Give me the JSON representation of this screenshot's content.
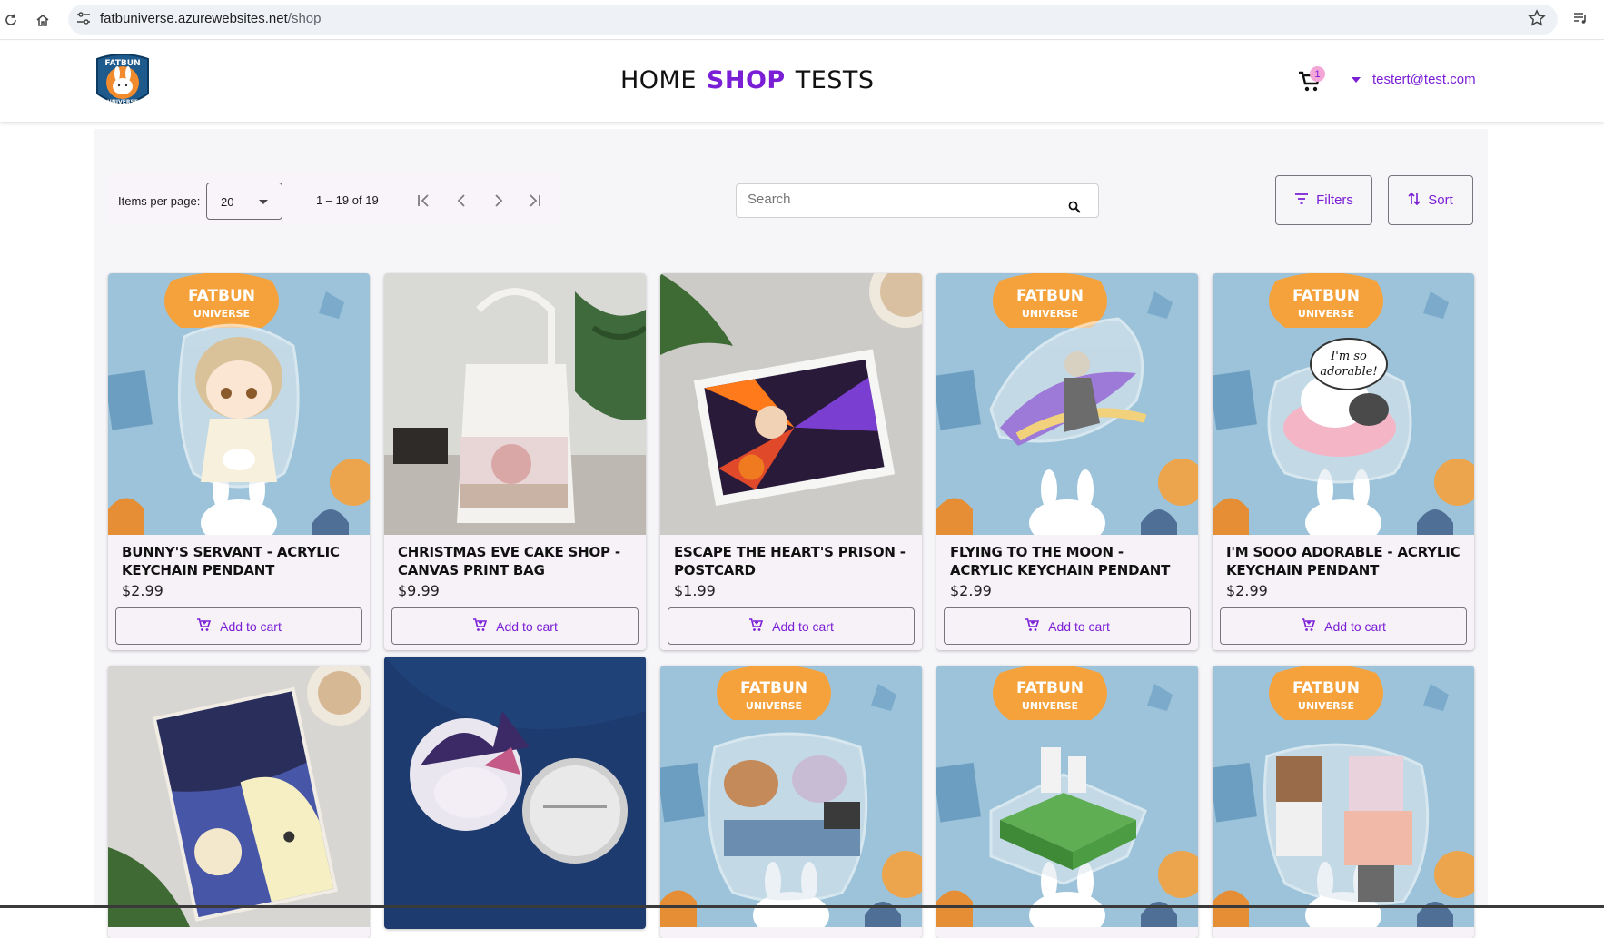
{
  "browser": {
    "url_host": "fatbuniverse.azurewebsites.net",
    "url_path": "/shop"
  },
  "header": {
    "nav": [
      {
        "label": "HOME",
        "active": false
      },
      {
        "label": "SHOP",
        "active": true
      },
      {
        "label": "TESTS",
        "active": false
      }
    ],
    "cart_count": "1",
    "user_email": "testert@test.com",
    "accent_color": "#7b1fd6"
  },
  "toolbar": {
    "items_per_page_label": "Items per page:",
    "items_per_page_value": "20",
    "range_label": "1 – 19 of 19",
    "search_placeholder": "Search",
    "filters_label": "Filters",
    "sort_label": "Sort"
  },
  "products": [
    {
      "title": "BUNNY'S SERVANT - ACRYLIC KEYCHAIN PENDANT",
      "price": "$2.99",
      "button": "Add to cart",
      "image": "acrylic-keychain"
    },
    {
      "title": "CHRISTMAS EVE CAKE SHOP - CANVAS PRINT BAG",
      "price": "$9.99",
      "button": "Add to cart",
      "image": "tote-bag"
    },
    {
      "title": "ESCAPE THE HEART'S PRISON - POSTCARD",
      "price": "$1.99",
      "button": "Add to cart",
      "image": "postcard"
    },
    {
      "title": "FLYING TO THE MOON - ACRYLIC KEYCHAIN PENDANT",
      "price": "$2.99",
      "button": "Add to cart",
      "image": "acrylic-keychain"
    },
    {
      "title": "I'M SOOO ADORABLE - ACRYLIC KEYCHAIN PENDANT",
      "price": "$2.99",
      "button": "Add to cart",
      "image": "acrylic-keychain"
    }
  ],
  "products_row2": [
    {
      "image": "book"
    },
    {
      "image": "pin-button"
    },
    {
      "image": "acrylic-keychain"
    },
    {
      "image": "acrylic-keychain"
    },
    {
      "image": "acrylic-keychain"
    }
  ],
  "keychain_art": {
    "brand_top": "FATBUN",
    "brand_bottom": "UNIVERSE",
    "speech_bubble": "I'm so adorable!"
  }
}
